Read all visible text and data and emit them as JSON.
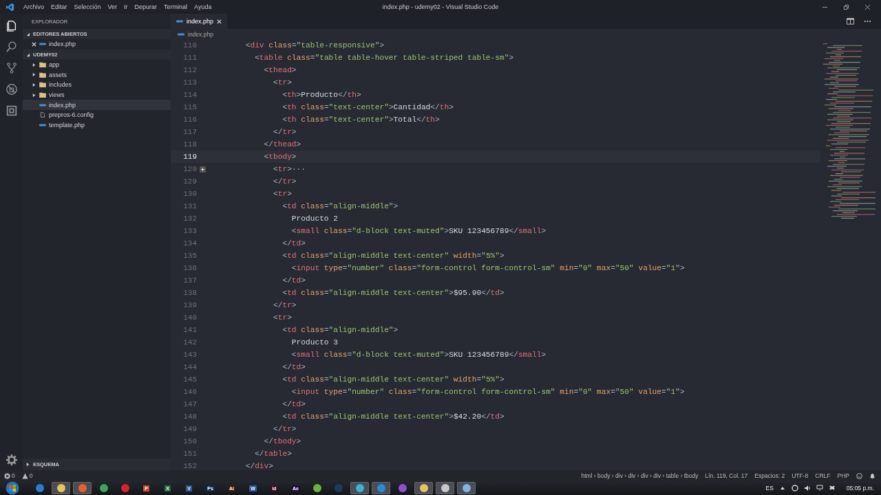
{
  "window": {
    "title": "index.php - udemy02 - Visual Studio Code"
  },
  "menu": [
    "Archivo",
    "Editar",
    "Selección",
    "Ver",
    "Ir",
    "Depurar",
    "Terminal",
    "Ayuda"
  ],
  "activity_bar": [
    {
      "kind": "explorer",
      "selected": true
    },
    {
      "kind": "search",
      "selected": false
    },
    {
      "kind": "source-control",
      "selected": false
    },
    {
      "kind": "debug",
      "selected": false
    },
    {
      "kind": "extensions",
      "selected": false
    }
  ],
  "sidebar": {
    "title": "EXPLORADOR",
    "sections": [
      {
        "kind": "open-editors",
        "label": "EDITORES ABIERTOS",
        "expanded": true,
        "items": [
          {
            "kind": "php",
            "label": "index.php",
            "selected": false
          }
        ]
      },
      {
        "kind": "folder",
        "label": "UDEMY02",
        "expanded": true,
        "items": [
          {
            "kind": "folder",
            "label": "app",
            "selected": false
          },
          {
            "kind": "folder",
            "label": "assets",
            "selected": false
          },
          {
            "kind": "folder",
            "label": "includes",
            "selected": false
          },
          {
            "kind": "folder",
            "label": "views",
            "selected": false
          },
          {
            "kind": "php",
            "label": "index.php",
            "selected": true
          },
          {
            "kind": "file",
            "label": "prepros-6.config",
            "selected": false
          },
          {
            "kind": "php",
            "label": "template.php",
            "selected": false
          }
        ]
      }
    ],
    "outline": {
      "label": "ESQUEMA",
      "expanded": false
    }
  },
  "tabs": [
    {
      "label": "index.php",
      "selected": true
    }
  ],
  "breadcrumb": "index.php",
  "code": [
    {
      "num": "110",
      "current": false,
      "folded": false,
      "tokens": [
        {
          "kind": "p",
          "text": "        <"
        },
        {
          "kind": "t",
          "text": "div"
        },
        {
          "kind": "a",
          "text": " class"
        },
        {
          "kind": "p",
          "text": "="
        },
        {
          "kind": "s",
          "text": "\"table-responsive\""
        },
        {
          "kind": "p",
          "text": ">"
        }
      ]
    },
    {
      "num": "111",
      "current": false,
      "folded": false,
      "tokens": [
        {
          "kind": "p",
          "text": "          <"
        },
        {
          "kind": "t",
          "text": "table"
        },
        {
          "kind": "a",
          "text": " class"
        },
        {
          "kind": "p",
          "text": "="
        },
        {
          "kind": "s",
          "text": "\"table table-hover table-striped table-sm\""
        },
        {
          "kind": "p",
          "text": ">"
        }
      ]
    },
    {
      "num": "112",
      "current": false,
      "folded": false,
      "tokens": [
        {
          "kind": "p",
          "text": "            <"
        },
        {
          "kind": "t",
          "text": "thead"
        },
        {
          "kind": "p",
          "text": ">"
        }
      ]
    },
    {
      "num": "113",
      "current": false,
      "folded": false,
      "tokens": [
        {
          "kind": "p",
          "text": "              <"
        },
        {
          "kind": "t",
          "text": "tr"
        },
        {
          "kind": "p",
          "text": ">"
        }
      ]
    },
    {
      "num": "114",
      "current": false,
      "folded": false,
      "tokens": [
        {
          "kind": "p",
          "text": "                <"
        },
        {
          "kind": "t",
          "text": "th"
        },
        {
          "kind": "p",
          "text": ">"
        },
        {
          "kind": "x",
          "text": "Producto"
        },
        {
          "kind": "p",
          "text": "</"
        },
        {
          "kind": "t",
          "text": "th"
        },
        {
          "kind": "p",
          "text": ">"
        }
      ]
    },
    {
      "num": "115",
      "current": false,
      "folded": false,
      "tokens": [
        {
          "kind": "p",
          "text": "                <"
        },
        {
          "kind": "t",
          "text": "th"
        },
        {
          "kind": "a",
          "text": " class"
        },
        {
          "kind": "p",
          "text": "="
        },
        {
          "kind": "s",
          "text": "\"text-center\""
        },
        {
          "kind": "p",
          "text": ">"
        },
        {
          "kind": "x",
          "text": "Cantidad"
        },
        {
          "kind": "p",
          "text": "</"
        },
        {
          "kind": "t",
          "text": "th"
        },
        {
          "kind": "p",
          "text": ">"
        }
      ]
    },
    {
      "num": "116",
      "current": false,
      "folded": false,
      "tokens": [
        {
          "kind": "p",
          "text": "                <"
        },
        {
          "kind": "t",
          "text": "th"
        },
        {
          "kind": "a",
          "text": " class"
        },
        {
          "kind": "p",
          "text": "="
        },
        {
          "kind": "s",
          "text": "\"text-center\""
        },
        {
          "kind": "p",
          "text": ">"
        },
        {
          "kind": "x",
          "text": "Total"
        },
        {
          "kind": "p",
          "text": "</"
        },
        {
          "kind": "t",
          "text": "th"
        },
        {
          "kind": "p",
          "text": ">"
        }
      ]
    },
    {
      "num": "117",
      "current": false,
      "folded": false,
      "tokens": [
        {
          "kind": "p",
          "text": "              </"
        },
        {
          "kind": "t",
          "text": "tr"
        },
        {
          "kind": "p",
          "text": ">"
        }
      ]
    },
    {
      "num": "118",
      "current": false,
      "folded": false,
      "tokens": [
        {
          "kind": "p",
          "text": "            </"
        },
        {
          "kind": "t",
          "text": "thead"
        },
        {
          "kind": "p",
          "text": ">"
        }
      ]
    },
    {
      "num": "119",
      "current": true,
      "folded": false,
      "tokens": [
        {
          "kind": "p",
          "text": "            <"
        },
        {
          "kind": "t",
          "text": "tbody"
        },
        {
          "kind": "p",
          "text": ">"
        }
      ]
    },
    {
      "num": "120",
      "current": false,
      "folded": true,
      "tokens": [
        {
          "kind": "p",
          "text": "              <"
        },
        {
          "kind": "t",
          "text": "tr"
        },
        {
          "kind": "p",
          "text": ">···"
        }
      ]
    },
    {
      "num": "129",
      "current": false,
      "folded": false,
      "tokens": [
        {
          "kind": "p",
          "text": "              </"
        },
        {
          "kind": "t",
          "text": "tr"
        },
        {
          "kind": "p",
          "text": ">"
        }
      ]
    },
    {
      "num": "130",
      "current": false,
      "folded": false,
      "tokens": [
        {
          "kind": "p",
          "text": "              <"
        },
        {
          "kind": "t",
          "text": "tr"
        },
        {
          "kind": "p",
          "text": ">"
        }
      ]
    },
    {
      "num": "131",
      "current": false,
      "folded": false,
      "tokens": [
        {
          "kind": "p",
          "text": "                <"
        },
        {
          "kind": "t",
          "text": "td"
        },
        {
          "kind": "a",
          "text": " class"
        },
        {
          "kind": "p",
          "text": "="
        },
        {
          "kind": "s",
          "text": "\"align-middle\""
        },
        {
          "kind": "p",
          "text": ">"
        }
      ]
    },
    {
      "num": "132",
      "current": false,
      "folded": false,
      "tokens": [
        {
          "kind": "x",
          "text": "                  Producto 2"
        }
      ]
    },
    {
      "num": "133",
      "current": false,
      "folded": false,
      "tokens": [
        {
          "kind": "p",
          "text": "                  <"
        },
        {
          "kind": "t",
          "text": "small"
        },
        {
          "kind": "a",
          "text": " class"
        },
        {
          "kind": "p",
          "text": "="
        },
        {
          "kind": "s",
          "text": "\"d-block text-muted\""
        },
        {
          "kind": "p",
          "text": ">"
        },
        {
          "kind": "x",
          "text": "SKU 123456789"
        },
        {
          "kind": "p",
          "text": "</"
        },
        {
          "kind": "t",
          "text": "small"
        },
        {
          "kind": "p",
          "text": ">"
        }
      ]
    },
    {
      "num": "134",
      "current": false,
      "folded": false,
      "tokens": [
        {
          "kind": "p",
          "text": "                </"
        },
        {
          "kind": "t",
          "text": "td"
        },
        {
          "kind": "p",
          "text": ">"
        }
      ]
    },
    {
      "num": "135",
      "current": false,
      "folded": false,
      "tokens": [
        {
          "kind": "p",
          "text": "                <"
        },
        {
          "kind": "t",
          "text": "td"
        },
        {
          "kind": "a",
          "text": " class"
        },
        {
          "kind": "p",
          "text": "="
        },
        {
          "kind": "s",
          "text": "\"align-middle text-center\""
        },
        {
          "kind": "a",
          "text": " width"
        },
        {
          "kind": "p",
          "text": "="
        },
        {
          "kind": "s",
          "text": "\"5%\""
        },
        {
          "kind": "p",
          "text": ">"
        }
      ]
    },
    {
      "num": "136",
      "current": false,
      "folded": false,
      "tokens": [
        {
          "kind": "p",
          "text": "                  <"
        },
        {
          "kind": "t",
          "text": "input"
        },
        {
          "kind": "a",
          "text": " type"
        },
        {
          "kind": "p",
          "text": "="
        },
        {
          "kind": "s",
          "text": "\"number\""
        },
        {
          "kind": "a",
          "text": " class"
        },
        {
          "kind": "p",
          "text": "="
        },
        {
          "kind": "s",
          "text": "\"form-control form-control-sm\""
        },
        {
          "kind": "a",
          "text": " min"
        },
        {
          "kind": "p",
          "text": "="
        },
        {
          "kind": "s",
          "text": "\"0\""
        },
        {
          "kind": "a",
          "text": " max"
        },
        {
          "kind": "p",
          "text": "="
        },
        {
          "kind": "s",
          "text": "\"50\""
        },
        {
          "kind": "a",
          "text": " value"
        },
        {
          "kind": "p",
          "text": "="
        },
        {
          "kind": "s",
          "text": "\"1\""
        },
        {
          "kind": "p",
          "text": ">"
        }
      ]
    },
    {
      "num": "137",
      "current": false,
      "folded": false,
      "tokens": [
        {
          "kind": "p",
          "text": "                </"
        },
        {
          "kind": "t",
          "text": "td"
        },
        {
          "kind": "p",
          "text": ">"
        }
      ]
    },
    {
      "num": "138",
      "current": false,
      "folded": false,
      "tokens": [
        {
          "kind": "p",
          "text": "                <"
        },
        {
          "kind": "t",
          "text": "td"
        },
        {
          "kind": "a",
          "text": " class"
        },
        {
          "kind": "p",
          "text": "="
        },
        {
          "kind": "s",
          "text": "\"align-middle text-center\""
        },
        {
          "kind": "p",
          "text": ">"
        },
        {
          "kind": "x",
          "text": "$95.90"
        },
        {
          "kind": "p",
          "text": "</"
        },
        {
          "kind": "t",
          "text": "td"
        },
        {
          "kind": "p",
          "text": ">"
        }
      ]
    },
    {
      "num": "139",
      "current": false,
      "folded": false,
      "tokens": [
        {
          "kind": "p",
          "text": "              </"
        },
        {
          "kind": "t",
          "text": "tr"
        },
        {
          "kind": "p",
          "text": ">"
        }
      ]
    },
    {
      "num": "140",
      "current": false,
      "folded": false,
      "tokens": [
        {
          "kind": "p",
          "text": "              <"
        },
        {
          "kind": "t",
          "text": "tr"
        },
        {
          "kind": "p",
          "text": ">"
        }
      ]
    },
    {
      "num": "141",
      "current": false,
      "folded": false,
      "tokens": [
        {
          "kind": "p",
          "text": "                <"
        },
        {
          "kind": "t",
          "text": "td"
        },
        {
          "kind": "a",
          "text": " class"
        },
        {
          "kind": "p",
          "text": "="
        },
        {
          "kind": "s",
          "text": "\"align-middle\""
        },
        {
          "kind": "p",
          "text": ">"
        }
      ]
    },
    {
      "num": "142",
      "current": false,
      "folded": false,
      "tokens": [
        {
          "kind": "x",
          "text": "                  Producto 3"
        }
      ]
    },
    {
      "num": "143",
      "current": false,
      "folded": false,
      "tokens": [
        {
          "kind": "p",
          "text": "                  <"
        },
        {
          "kind": "t",
          "text": "small"
        },
        {
          "kind": "a",
          "text": " class"
        },
        {
          "kind": "p",
          "text": "="
        },
        {
          "kind": "s",
          "text": "\"d-block text-muted\""
        },
        {
          "kind": "p",
          "text": ">"
        },
        {
          "kind": "x",
          "text": "SKU 123456789"
        },
        {
          "kind": "p",
          "text": "</"
        },
        {
          "kind": "t",
          "text": "small"
        },
        {
          "kind": "p",
          "text": ">"
        }
      ]
    },
    {
      "num": "144",
      "current": false,
      "folded": false,
      "tokens": [
        {
          "kind": "p",
          "text": "                </"
        },
        {
          "kind": "t",
          "text": "td"
        },
        {
          "kind": "p",
          "text": ">"
        }
      ]
    },
    {
      "num": "145",
      "current": false,
      "folded": false,
      "tokens": [
        {
          "kind": "p",
          "text": "                <"
        },
        {
          "kind": "t",
          "text": "td"
        },
        {
          "kind": "a",
          "text": " class"
        },
        {
          "kind": "p",
          "text": "="
        },
        {
          "kind": "s",
          "text": "\"align-middle text-center\""
        },
        {
          "kind": "a",
          "text": " width"
        },
        {
          "kind": "p",
          "text": "="
        },
        {
          "kind": "s",
          "text": "\"5%\""
        },
        {
          "kind": "p",
          "text": ">"
        }
      ]
    },
    {
      "num": "146",
      "current": false,
      "folded": false,
      "tokens": [
        {
          "kind": "p",
          "text": "                  <"
        },
        {
          "kind": "t",
          "text": "input"
        },
        {
          "kind": "a",
          "text": " type"
        },
        {
          "kind": "p",
          "text": "="
        },
        {
          "kind": "s",
          "text": "\"number\""
        },
        {
          "kind": "a",
          "text": " class"
        },
        {
          "kind": "p",
          "text": "="
        },
        {
          "kind": "s",
          "text": "\"form-control form-control-sm\""
        },
        {
          "kind": "a",
          "text": " min"
        },
        {
          "kind": "p",
          "text": "="
        },
        {
          "kind": "s",
          "text": "\"0\""
        },
        {
          "kind": "a",
          "text": " max"
        },
        {
          "kind": "p",
          "text": "="
        },
        {
          "kind": "s",
          "text": "\"50\""
        },
        {
          "kind": "a",
          "text": " value"
        },
        {
          "kind": "p",
          "text": "="
        },
        {
          "kind": "s",
          "text": "\"1\""
        },
        {
          "kind": "p",
          "text": ">"
        }
      ]
    },
    {
      "num": "147",
      "current": false,
      "folded": false,
      "tokens": [
        {
          "kind": "p",
          "text": "                </"
        },
        {
          "kind": "t",
          "text": "td"
        },
        {
          "kind": "p",
          "text": ">"
        }
      ]
    },
    {
      "num": "148",
      "current": false,
      "folded": false,
      "tokens": [
        {
          "kind": "p",
          "text": "                <"
        },
        {
          "kind": "t",
          "text": "td"
        },
        {
          "kind": "a",
          "text": " class"
        },
        {
          "kind": "p",
          "text": "="
        },
        {
          "kind": "s",
          "text": "\"align-middle text-center\""
        },
        {
          "kind": "p",
          "text": ">"
        },
        {
          "kind": "x",
          "text": "$42.20"
        },
        {
          "kind": "p",
          "text": "</"
        },
        {
          "kind": "t",
          "text": "td"
        },
        {
          "kind": "p",
          "text": ">"
        }
      ]
    },
    {
      "num": "149",
      "current": false,
      "folded": false,
      "tokens": [
        {
          "kind": "p",
          "text": "              </"
        },
        {
          "kind": "t",
          "text": "tr"
        },
        {
          "kind": "p",
          "text": ">"
        }
      ]
    },
    {
      "num": "150",
      "current": false,
      "folded": false,
      "tokens": [
        {
          "kind": "p",
          "text": "            </"
        },
        {
          "kind": "t",
          "text": "tbody"
        },
        {
          "kind": "p",
          "text": ">"
        }
      ]
    },
    {
      "num": "151",
      "current": false,
      "folded": false,
      "tokens": [
        {
          "kind": "p",
          "text": "          </"
        },
        {
          "kind": "t",
          "text": "table"
        },
        {
          "kind": "p",
          "text": ">"
        }
      ]
    },
    {
      "num": "152",
      "current": false,
      "folded": false,
      "tokens": [
        {
          "kind": "p",
          "text": "        </"
        },
        {
          "kind": "t",
          "text": "div"
        },
        {
          "kind": "p",
          "text": ">"
        }
      ]
    }
  ],
  "status_bar": {
    "errors": "0",
    "warnings": "0",
    "path": "html › body › div › div › div › div › table › tbody",
    "position": "Lín. 119, Col. 17",
    "indent": "Espacios: 2",
    "encoding": "UTF-8",
    "eol": "CRLF",
    "language": "PHP"
  },
  "taskbar": {
    "apps": [
      {
        "color": "#2b7bd6",
        "active": false
      },
      {
        "color": "#e8c45a",
        "active": true
      },
      {
        "color": "#e8612c",
        "active": true
      },
      {
        "color": "#3aa757",
        "active": false
      },
      {
        "color": "#d9222a",
        "active": false
      },
      {
        "label": "P",
        "color": "#c9472b",
        "active": false
      },
      {
        "label": "X",
        "color": "#1e7145",
        "active": false
      },
      {
        "label": "V",
        "color": "#2b579a",
        "active": false
      },
      {
        "label": "Ps",
        "color": "#0d2a4a",
        "active": false
      },
      {
        "label": "Ai",
        "color": "#3a1d05",
        "active": false
      },
      {
        "label": "W",
        "color": "#2b579a",
        "active": false
      },
      {
        "label": "Id",
        "color": "#3d0b20",
        "active": false
      },
      {
        "label": "Ae",
        "color": "#1f0b3d",
        "active": false
      },
      {
        "color": "#6bb33a",
        "active": false
      },
      {
        "color": "#1b3b5e",
        "active": false
      },
      {
        "color": "#38b2d6",
        "active": true
      },
      {
        "color": "#2a8ad8",
        "active": true
      },
      {
        "color": "#8e4fd1",
        "active": false
      },
      {
        "color": "#e6c45a",
        "active": true
      },
      {
        "color": "#c8c8c8",
        "active": true
      },
      {
        "color": "#7fb4e0",
        "active": true
      }
    ],
    "language": "ES",
    "clock": "05:05 p.m."
  }
}
